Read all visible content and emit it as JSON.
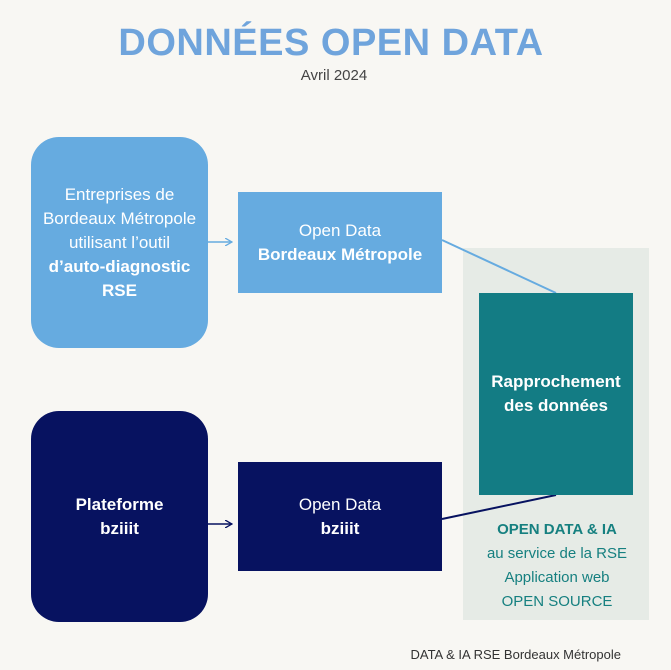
{
  "header": {
    "title": "DONNÉES OPEN DATA",
    "subtitle": "Avril 2024"
  },
  "nodes": {
    "entreprises": {
      "line1": "Entreprises de",
      "line2": "Bordeaux Métropole",
      "line3": "utilisant l’outil",
      "line4": "d’auto-diagnostic",
      "line5": "RSE"
    },
    "open_data_bm": {
      "line1": "Open Data",
      "line2": "Bordeaux Métropole"
    },
    "plateforme": {
      "line1": "Plateforme",
      "line2": "bziiit"
    },
    "open_data_bziiit": {
      "line1": "Open Data",
      "line2": "bziiit"
    },
    "rapprochement": {
      "line1": "Rapprochement",
      "line2": "des données"
    }
  },
  "caption": {
    "line1": "OPEN DATA & IA",
    "line2": "au service de la RSE",
    "line3": "Application web",
    "line4": "OPEN SOURCE"
  },
  "footer": "DATA & IA RSE Bordeaux Métropole",
  "colors": {
    "title": "#6fa4dc",
    "light_blue": "#66abe0",
    "navy": "#071260",
    "teal": "#137c84",
    "panel": "#e6ebe6",
    "background": "#f8f7f3"
  }
}
